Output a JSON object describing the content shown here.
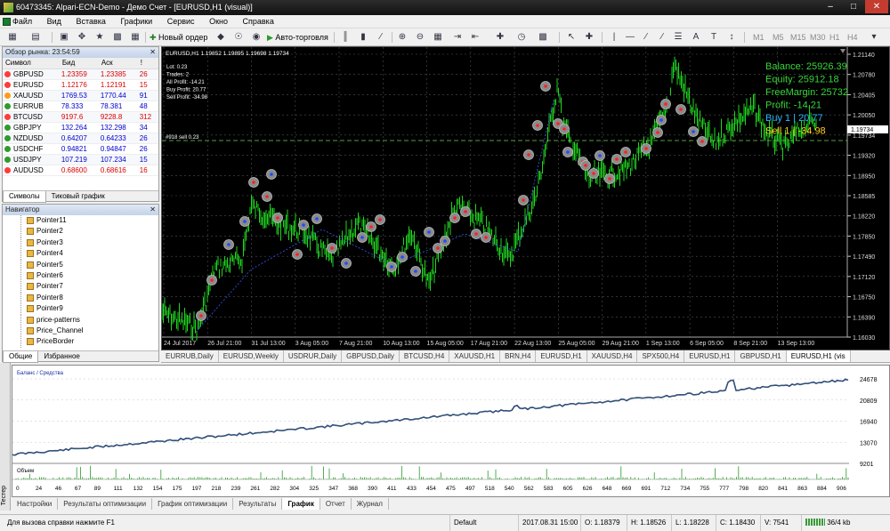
{
  "window": {
    "title": "60473345: Alpari-ECN-Demo - Демо Счет - [EURUSD,H1 (visual)]"
  },
  "menu": [
    "Файл",
    "Вид",
    "Вставка",
    "Графики",
    "Сервис",
    "Окно",
    "Справка"
  ],
  "toolbar": {
    "new_order": "Новый ордер",
    "auto_trading": "Авто-торговля",
    "periods": [
      "M1",
      "M5",
      "M15",
      "M30",
      "H1",
      "H4"
    ]
  },
  "market_watch": {
    "title": "Обзор рынка: 23:54:59",
    "headers": [
      "Символ",
      "Бид",
      "Аск",
      "!"
    ],
    "rows": [
      {
        "symbol": "GBPUSD",
        "bid": "1.23359",
        "ask": "1.23385",
        "spread": "26",
        "color": "#ff3b3b"
      },
      {
        "symbol": "EURUSD",
        "bid": "1.12176",
        "ask": "1.12191",
        "spread": "15",
        "color": "#ff3b3b"
      },
      {
        "symbol": "XAUUSD",
        "bid": "1769.53",
        "ask": "1770.44",
        "spread": "91",
        "color": "#ff9c1a"
      },
      {
        "symbol": "EURRUB",
        "bid": "78.333",
        "ask": "78.381",
        "spread": "48",
        "color": "#2d9c2d"
      },
      {
        "symbol": "BTCUSD",
        "bid": "9197.6",
        "ask": "9228.8",
        "spread": "312",
        "color": "#ff3b3b"
      },
      {
        "symbol": "GBPJPY",
        "bid": "132.264",
        "ask": "132.298",
        "spread": "34",
        "color": "#2d9c2d"
      },
      {
        "symbol": "NZDUSD",
        "bid": "0.64207",
        "ask": "0.64233",
        "spread": "26",
        "color": "#2d9c2d"
      },
      {
        "symbol": "USDCHF",
        "bid": "0.94821",
        "ask": "0.94847",
        "spread": "26",
        "color": "#2d9c2d"
      },
      {
        "symbol": "USDJPY",
        "bid": "107.219",
        "ask": "107.234",
        "spread": "15",
        "color": "#2d9c2d"
      },
      {
        "symbol": "AUDUSD",
        "bid": "0.68600",
        "ask": "0.68616",
        "spread": "16",
        "color": "#ff3b3b"
      }
    ],
    "tabs": [
      "Символы",
      "Тиковый график"
    ]
  },
  "navigator": {
    "title": "Навигатор",
    "items": [
      "Pointer11",
      "Pointer2",
      "Pointer3",
      "Pointer4",
      "Pointer5",
      "Pointer6",
      "Pointer7",
      "Pointer8",
      "Pointer9",
      "price-patterns",
      "Price_Channel",
      "PriceBorder"
    ],
    "tabs": [
      "Общие",
      "Избранное"
    ]
  },
  "chart": {
    "symbol_line": "EURUSD,H1  1.19852 1.19895 1.19698 1.19734",
    "info": [
      "Lot: 0.23",
      "Trades: 2",
      "All Profit: -14.21",
      "Buy Profit: 20.77",
      "Sell Profit: -34.98"
    ],
    "stats": [
      {
        "text": "Balance: 25926.39",
        "color": "#39d53a"
      },
      {
        "text": "Equity: 25912.18",
        "color": "#39d53a"
      },
      {
        "text": "FreeMargin: 25732",
        "color": "#39d53a"
      },
      {
        "text": "Profit: -14.21",
        "color": "#39d53a"
      },
      {
        "text": "Buy 1  |  20.77",
        "color": "#2ab8ff"
      },
      {
        "text": "Sell 1  |  -34.98",
        "color": "#ffd21a"
      }
    ],
    "order_label": "#918 sell 0.23",
    "price_labels": [
      "1.21140",
      "1.20780",
      "1.20405",
      "1.20050",
      "1.19734",
      "1.19320",
      "1.18950",
      "1.18585",
      "1.18220",
      "1.17850",
      "1.17490",
      "1.17120",
      "1.16750",
      "1.16390",
      "1.16030"
    ],
    "current_price": "1.19734",
    "time_labels": [
      "24 Jul 2017",
      "26 Jul 21:00",
      "31 Jul 13:00",
      "3 Aug 05:00",
      "7 Aug 21:00",
      "10 Aug 13:00",
      "15 Aug 05:00",
      "17 Aug 21:00",
      "22 Aug 13:00",
      "25 Aug 05:00",
      "29 Aug 21:00",
      "1 Sep 13:00",
      "6 Sep 05:00",
      "8 Sep 21:00",
      "13 Sep 13:00"
    ]
  },
  "chart_tabs": [
    "EURRUB,Daily",
    "EURUSD,Weekly",
    "USDRUR,Daily",
    "GBPUSD,Daily",
    "BTCUSD,H4",
    "XAUUSD,H1",
    "BRN,H4",
    "EURUSD,H1",
    "XAUUSD,H4",
    "SPX500,H4",
    "EURUSD,H1",
    "GBPUSD,H1",
    "EURUSD,H1 (vis"
  ],
  "chart_tab_active": 12,
  "tester": {
    "side_label": "Тестер",
    "balance_legend": "Баланс / Средства",
    "volume_legend": "Объем",
    "y_labels": [
      "24678",
      "20809",
      "16940",
      "13070",
      "9201"
    ],
    "x_labels": [
      "0",
      "24",
      "46",
      "67",
      "89",
      "111",
      "132",
      "154",
      "175",
      "197",
      "218",
      "239",
      "261",
      "282",
      "304",
      "325",
      "347",
      "368",
      "390",
      "411",
      "433",
      "454",
      "475",
      "497",
      "518",
      "540",
      "562",
      "583",
      "605",
      "626",
      "648",
      "669",
      "691",
      "712",
      "734",
      "755",
      "777",
      "798",
      "820",
      "841",
      "863",
      "884",
      "906"
    ],
    "tabs": [
      "Настройки",
      "Результаты оптимизации",
      "График оптимизации",
      "Результаты",
      "График",
      "Отчет",
      "Журнал"
    ],
    "active_tab": 4
  },
  "status": {
    "help": "Для вызова справки нажмите F1",
    "profile": "Default",
    "time": "2017.08.31 15:00",
    "open": "O: 1.18379",
    "high": "H: 1.18526",
    "low": "L: 1.18228",
    "close": "C: 1.18430",
    "volume": "V: 7541",
    "traffic": "36/4 kb"
  }
}
